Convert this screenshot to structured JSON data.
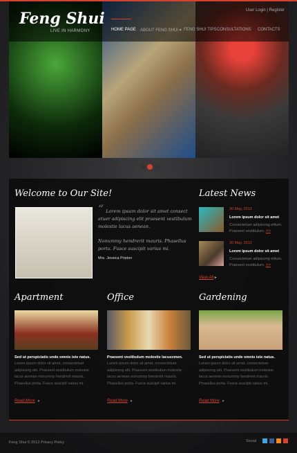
{
  "header": {
    "logo": "Feng Shui",
    "tagline": "LIVE IN HARMONY",
    "user_login": "User Login",
    "separator": "|",
    "register": "Register",
    "nav": [
      "HOME PAGE",
      "ABOUT FENG SHUI",
      "FENG SHUI TIPS",
      "CONSULTATIONS",
      "CONTACTS"
    ],
    "nav_dropdown": "▾"
  },
  "welcome": {
    "title": "Welcome to Our Site!",
    "quote_mark": "“",
    "p1": "Lorem ipsum dolor sit amet consect etuer adipiscing elit praesent vestibulum molestie lacus aenean.",
    "p2": "Nonummy hendrerit mauris. Phasellus porta. Fusce suscipit varius mi.",
    "author": "Mrs. Jessica Priston"
  },
  "news": {
    "title": "Latest News",
    "items": [
      {
        "date": "30 May, 2012",
        "title": "Lorem ipsum dolor sit amet",
        "text": "Consectetuer adipiscing elitum. Praesent vestibulum.",
        "more": ">>"
      },
      {
        "date": "30 May, 2012",
        "title": "Lorem ipsum dolor sit amet",
        "text": "Consectetuer adipiscing elitum. Praesent vestibulum.",
        "more": ">>"
      }
    ],
    "view_all": "View All"
  },
  "columns": [
    {
      "title": "Apartment",
      "heading": "Sed ut perspiciatis unde omnis iste natus.",
      "text": "Lorem ipsum dolor sit amet, consectetuer adipiscing elit. Praesent vestibulum molestie lacus aenean nonummy hendrerit mauris. Phasellus porta. Fusce suscipit varius mi.",
      "more": "Read More"
    },
    {
      "title": "Office",
      "heading": "Praesent vestibulum molestie lacusomen.",
      "text": "Lorem ipsum dolor sit amet, consectetuer adipiscing elit. Praesent vestibulum molestie lacus aenean nonummy hendrerit mauris. Phasellus porta. Fusce suscipit varius mi.",
      "more": "Read More"
    },
    {
      "title": "Gardening",
      "heading": "Sed ut perspiciatis unde omnis iste natus.",
      "text": "Lorem ipsum dolor sit amet, consectetuer adipiscing elit. Praesent vestibulum molestie lacus aenean nonummy hendrerit mauris. Phasellus porta. Fusce suscipit varius mi.",
      "more": "Read More"
    }
  ],
  "footer": {
    "copyright": "Feng Shui © 2012",
    "privacy": "Privacy Policy",
    "social_label": "Social"
  },
  "colors": {
    "accent": "#d8412e"
  }
}
